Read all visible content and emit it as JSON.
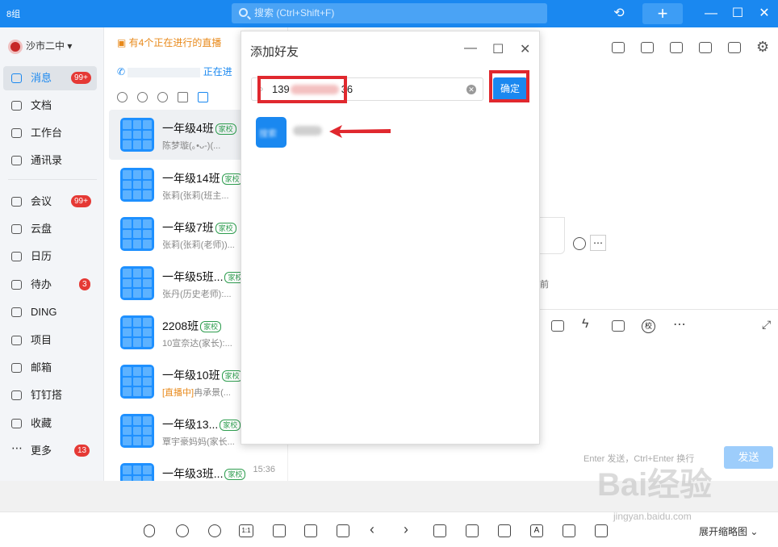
{
  "titlebar": {
    "logo": "8组",
    "search_placeholder": "搜索 (Ctrl+Shift+F)",
    "plus": "+"
  },
  "sidebar": {
    "org": "沙市二中",
    "items": [
      {
        "label": "消息",
        "badge": "99+"
      },
      {
        "label": "文档",
        "badge": ""
      },
      {
        "label": "工作台",
        "badge": ""
      },
      {
        "label": "通讯录",
        "badge": ""
      },
      {
        "label": "会议",
        "badge": "99+"
      },
      {
        "label": "云盘",
        "badge": ""
      },
      {
        "label": "日历",
        "badge": ""
      },
      {
        "label": "待办",
        "badge": "3"
      },
      {
        "label": "DING",
        "badge": ""
      },
      {
        "label": "项目",
        "badge": ""
      },
      {
        "label": "邮箱",
        "badge": ""
      },
      {
        "label": "钉钉搭",
        "badge": ""
      },
      {
        "label": "收藏",
        "badge": ""
      },
      {
        "label": "更多",
        "badge": "13"
      }
    ]
  },
  "chatlist": {
    "live_banner": "有4个正在进行的直播",
    "call_banner": "正在进",
    "conversations": [
      {
        "name": "一年级4班",
        "tag": "家校",
        "preview": "陈梦璇(｡•ᴗ-)(...",
        "time": ""
      },
      {
        "name": "一年级14班",
        "tag": "家校",
        "preview": "张莉(张莉(班主...",
        "time": ""
      },
      {
        "name": "一年级7班",
        "tag": "家校",
        "preview": "张莉(张莉(老师))...",
        "time": ""
      },
      {
        "name": "一年级5班...",
        "tag": "家校",
        "preview": "张丹(历史老师):...",
        "time": ""
      },
      {
        "name": "2208班",
        "tag": "家校",
        "preview": "10宣奈达(家长):...",
        "time": ""
      },
      {
        "name": "一年级10班",
        "tag": "家校",
        "preview_live": "[直播中]",
        "preview": "冉承景(...",
        "time": ""
      },
      {
        "name": "一年级13...",
        "tag": "家校",
        "preview": "覃宇豪妈妈(家长...",
        "time": ""
      },
      {
        "name": "一年级3班...",
        "tag": "家校",
        "preview": "",
        "time": "15:36"
      }
    ]
  },
  "right": {
    "partial_text": "前",
    "send_hint": "Enter 发送，Ctrl+Enter 换行",
    "send": "发送"
  },
  "dialog": {
    "title": "添加好友",
    "input_value": "139",
    "input_suffix": "36",
    "confirm": "确定",
    "result_avatar_text": "搜索"
  },
  "viewer": {
    "expand": "展开缩略图"
  },
  "watermark": {
    "brand": "Bai经验",
    "url": "jingyan.baidu.com"
  }
}
